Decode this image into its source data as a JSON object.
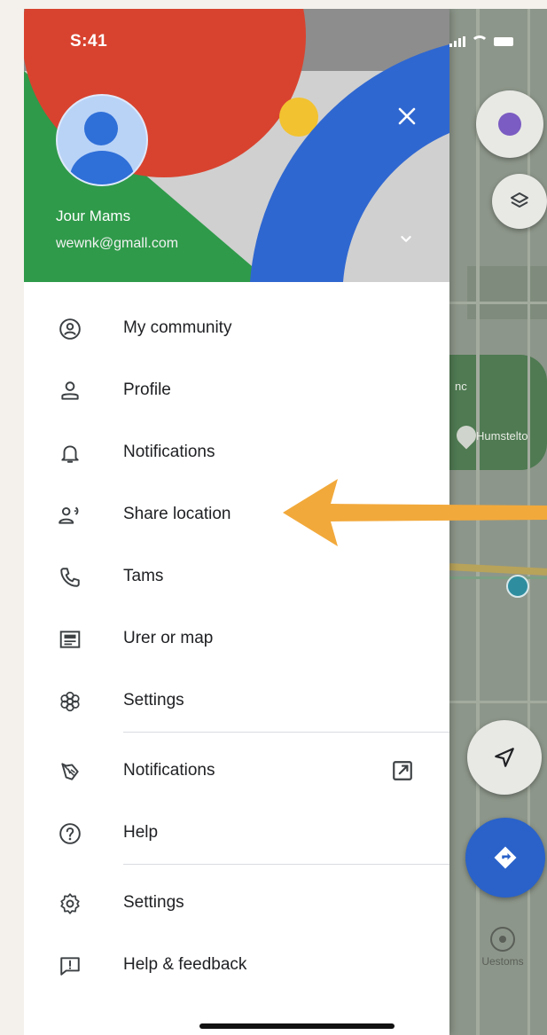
{
  "status_bar": {
    "time": "S:41"
  },
  "account": {
    "name": "Jour Mams",
    "email": "wewnk@gmall.com"
  },
  "menu_items": [
    {
      "label": "My community",
      "icon": "community-icon"
    },
    {
      "label": "Profile",
      "icon": "profile-icon"
    },
    {
      "label": "Notifications",
      "icon": "bell-icon"
    },
    {
      "label": "Share location",
      "icon": "share-location-icon"
    },
    {
      "label": "Tams",
      "icon": "phone-icon"
    },
    {
      "label": "Urer or map",
      "icon": "map-card-icon"
    },
    {
      "label": "Settings",
      "icon": "flower-settings-icon"
    }
  ],
  "menu_items_2": [
    {
      "label": "Notifications",
      "icon": "leaf-icon",
      "trailing_icon": "open-external-icon"
    },
    {
      "label": "Help",
      "icon": "help-icon"
    }
  ],
  "menu_items_3": [
    {
      "label": "Settings",
      "icon": "gear-icon"
    },
    {
      "label": "Help & feedback",
      "icon": "feedback-icon"
    }
  ],
  "map": {
    "labels": [
      "nc",
      "Humstelto"
    ],
    "bottom_tab_label": "Uestoms"
  },
  "colors": {
    "accent_blue": "#2a62c9",
    "highlight_arrow": "#f2a93b",
    "google_red": "#d8432f",
    "google_green": "#2f9a4a",
    "google_yellow": "#f2c230"
  }
}
